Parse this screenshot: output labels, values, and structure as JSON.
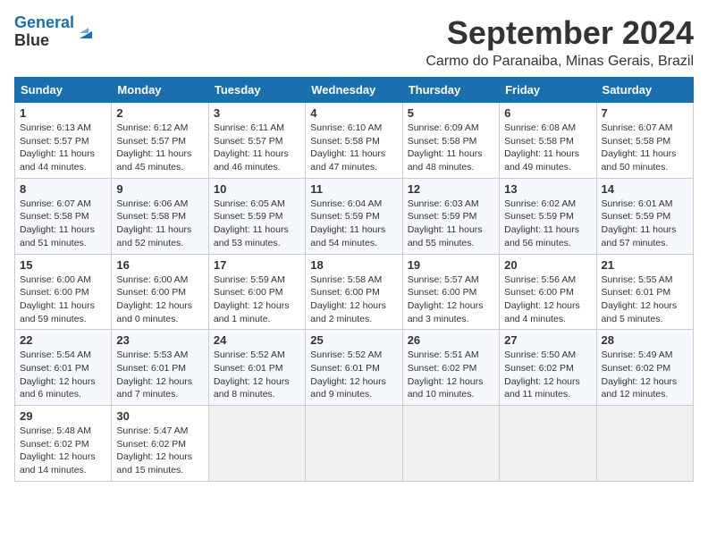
{
  "header": {
    "logo_line1": "General",
    "logo_line2": "Blue",
    "month_year": "September 2024",
    "location": "Carmo do Paranaiba, Minas Gerais, Brazil"
  },
  "weekdays": [
    "Sunday",
    "Monday",
    "Tuesday",
    "Wednesday",
    "Thursday",
    "Friday",
    "Saturday"
  ],
  "weeks": [
    [
      {
        "day": "1",
        "sunrise": "6:13 AM",
        "sunset": "5:57 PM",
        "daylight": "11 hours and 44 minutes."
      },
      {
        "day": "2",
        "sunrise": "6:12 AM",
        "sunset": "5:57 PM",
        "daylight": "11 hours and 45 minutes."
      },
      {
        "day": "3",
        "sunrise": "6:11 AM",
        "sunset": "5:57 PM",
        "daylight": "11 hours and 46 minutes."
      },
      {
        "day": "4",
        "sunrise": "6:10 AM",
        "sunset": "5:58 PM",
        "daylight": "11 hours and 47 minutes."
      },
      {
        "day": "5",
        "sunrise": "6:09 AM",
        "sunset": "5:58 PM",
        "daylight": "11 hours and 48 minutes."
      },
      {
        "day": "6",
        "sunrise": "6:08 AM",
        "sunset": "5:58 PM",
        "daylight": "11 hours and 49 minutes."
      },
      {
        "day": "7",
        "sunrise": "6:07 AM",
        "sunset": "5:58 PM",
        "daylight": "11 hours and 50 minutes."
      }
    ],
    [
      {
        "day": "8",
        "sunrise": "6:07 AM",
        "sunset": "5:58 PM",
        "daylight": "11 hours and 51 minutes."
      },
      {
        "day": "9",
        "sunrise": "6:06 AM",
        "sunset": "5:58 PM",
        "daylight": "11 hours and 52 minutes."
      },
      {
        "day": "10",
        "sunrise": "6:05 AM",
        "sunset": "5:59 PM",
        "daylight": "11 hours and 53 minutes."
      },
      {
        "day": "11",
        "sunrise": "6:04 AM",
        "sunset": "5:59 PM",
        "daylight": "11 hours and 54 minutes."
      },
      {
        "day": "12",
        "sunrise": "6:03 AM",
        "sunset": "5:59 PM",
        "daylight": "11 hours and 55 minutes."
      },
      {
        "day": "13",
        "sunrise": "6:02 AM",
        "sunset": "5:59 PM",
        "daylight": "11 hours and 56 minutes."
      },
      {
        "day": "14",
        "sunrise": "6:01 AM",
        "sunset": "5:59 PM",
        "daylight": "11 hours and 57 minutes."
      }
    ],
    [
      {
        "day": "15",
        "sunrise": "6:00 AM",
        "sunset": "6:00 PM",
        "daylight": "11 hours and 59 minutes."
      },
      {
        "day": "16",
        "sunrise": "6:00 AM",
        "sunset": "6:00 PM",
        "daylight": "12 hours and 0 minutes."
      },
      {
        "day": "17",
        "sunrise": "5:59 AM",
        "sunset": "6:00 PM",
        "daylight": "12 hours and 1 minute."
      },
      {
        "day": "18",
        "sunrise": "5:58 AM",
        "sunset": "6:00 PM",
        "daylight": "12 hours and 2 minutes."
      },
      {
        "day": "19",
        "sunrise": "5:57 AM",
        "sunset": "6:00 PM",
        "daylight": "12 hours and 3 minutes."
      },
      {
        "day": "20",
        "sunrise": "5:56 AM",
        "sunset": "6:00 PM",
        "daylight": "12 hours and 4 minutes."
      },
      {
        "day": "21",
        "sunrise": "5:55 AM",
        "sunset": "6:01 PM",
        "daylight": "12 hours and 5 minutes."
      }
    ],
    [
      {
        "day": "22",
        "sunrise": "5:54 AM",
        "sunset": "6:01 PM",
        "daylight": "12 hours and 6 minutes."
      },
      {
        "day": "23",
        "sunrise": "5:53 AM",
        "sunset": "6:01 PM",
        "daylight": "12 hours and 7 minutes."
      },
      {
        "day": "24",
        "sunrise": "5:52 AM",
        "sunset": "6:01 PM",
        "daylight": "12 hours and 8 minutes."
      },
      {
        "day": "25",
        "sunrise": "5:52 AM",
        "sunset": "6:01 PM",
        "daylight": "12 hours and 9 minutes."
      },
      {
        "day": "26",
        "sunrise": "5:51 AM",
        "sunset": "6:02 PM",
        "daylight": "12 hours and 10 minutes."
      },
      {
        "day": "27",
        "sunrise": "5:50 AM",
        "sunset": "6:02 PM",
        "daylight": "12 hours and 11 minutes."
      },
      {
        "day": "28",
        "sunrise": "5:49 AM",
        "sunset": "6:02 PM",
        "daylight": "12 hours and 12 minutes."
      }
    ],
    [
      {
        "day": "29",
        "sunrise": "5:48 AM",
        "sunset": "6:02 PM",
        "daylight": "12 hours and 14 minutes."
      },
      {
        "day": "30",
        "sunrise": "5:47 AM",
        "sunset": "6:02 PM",
        "daylight": "12 hours and 15 minutes."
      },
      null,
      null,
      null,
      null,
      null
    ]
  ]
}
